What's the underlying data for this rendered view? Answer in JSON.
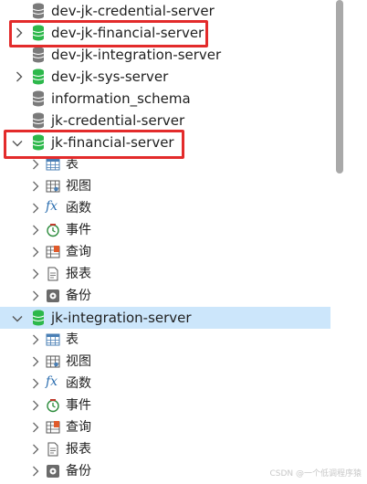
{
  "tree": {
    "databases_top": [
      {
        "label": "dev-jk-credential-server",
        "active": false,
        "expanded": false
      },
      {
        "label": "dev-jk-financial-server",
        "active": true,
        "expanded": false
      },
      {
        "label": "dev-jk-integration-server",
        "active": false,
        "expanded": false
      },
      {
        "label": "dev-jk-sys-server",
        "active": true,
        "expanded": false
      },
      {
        "label": "information_schema",
        "active": false,
        "expanded": false
      },
      {
        "label": "jk-credential-server",
        "active": false,
        "expanded": false
      },
      {
        "label": "jk-financial-server",
        "active": true,
        "expanded": true
      }
    ],
    "financial_children": [
      "表",
      "视图",
      "函数",
      "事件",
      "查询",
      "报表",
      "备份"
    ],
    "integration": {
      "label": "jk-integration-server",
      "active": true,
      "expanded": true
    },
    "integration_children": [
      "表",
      "视图",
      "函数",
      "事件",
      "查询",
      "报表",
      "备份"
    ]
  },
  "colors": {
    "active_db": "#2db84b",
    "inactive_db": "#7a7a7a",
    "highlight": "#e32b2b",
    "selection": "#cce6fb"
  },
  "icons": {
    "table": "table-icon",
    "view": "view-icon",
    "function": "function-icon",
    "event": "clock-icon",
    "query": "query-icon",
    "report": "report-icon",
    "backup": "backup-icon"
  },
  "watermark": "CSDN @一个低调程序猿"
}
